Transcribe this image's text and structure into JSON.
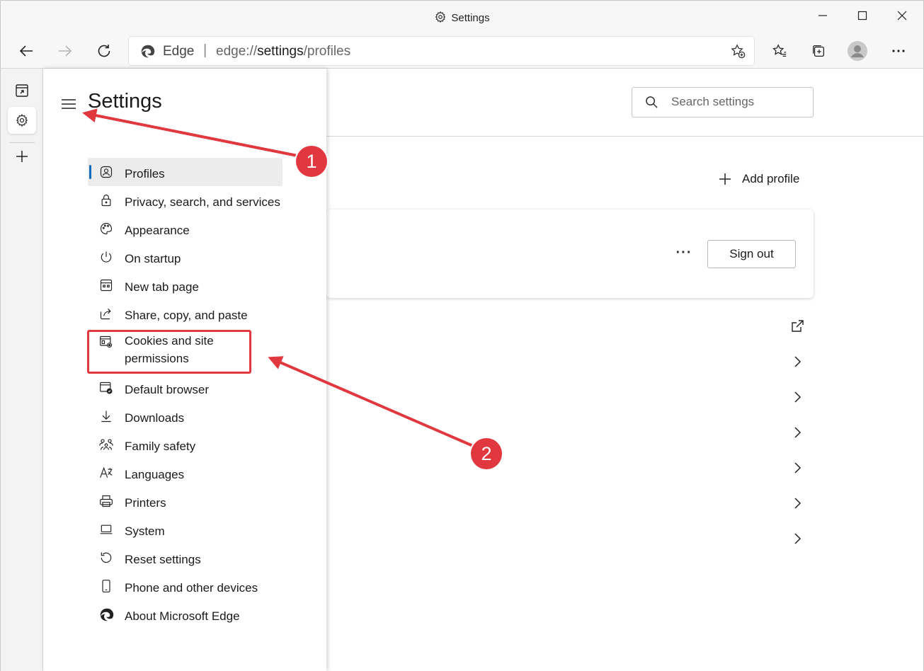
{
  "window": {
    "title": "Settings",
    "controls": [
      "minimize",
      "maximize",
      "close"
    ]
  },
  "toolbar": {
    "address": {
      "site_label": "Edge",
      "separator": "|",
      "url_prefix": "edge://",
      "url_bold": "settings",
      "url_suffix": "/profiles"
    }
  },
  "sidebar": {
    "title": "Settings",
    "items": [
      {
        "label": "Profiles",
        "icon": "profile-icon",
        "active": true
      },
      {
        "label": "Privacy, search, and services",
        "icon": "lock-icon"
      },
      {
        "label": "Appearance",
        "icon": "palette-icon"
      },
      {
        "label": "On startup",
        "icon": "power-icon"
      },
      {
        "label": "New tab page",
        "icon": "grid-icon"
      },
      {
        "label": "Share, copy, and paste",
        "icon": "share-icon"
      },
      {
        "label": "Cookies and site permissions",
        "icon": "site-permissions-icon"
      },
      {
        "label": "Default browser",
        "icon": "default-browser-icon"
      },
      {
        "label": "Downloads",
        "icon": "download-icon"
      },
      {
        "label": "Family safety",
        "icon": "family-icon"
      },
      {
        "label": "Languages",
        "icon": "language-icon"
      },
      {
        "label": "Printers",
        "icon": "printer-icon"
      },
      {
        "label": "System",
        "icon": "laptop-icon"
      },
      {
        "label": "Reset settings",
        "icon": "reset-icon"
      },
      {
        "label": "Phone and other devices",
        "icon": "phone-icon"
      },
      {
        "label": "About Microsoft Edge",
        "icon": "edge-icon"
      }
    ]
  },
  "content": {
    "search_placeholder": "Search settings",
    "add_profile_label": "Add profile",
    "more_label": "···",
    "signout_label": "Sign out"
  },
  "annotations": {
    "badge_1": "1",
    "badge_2": "2",
    "color": "#e0383e"
  }
}
